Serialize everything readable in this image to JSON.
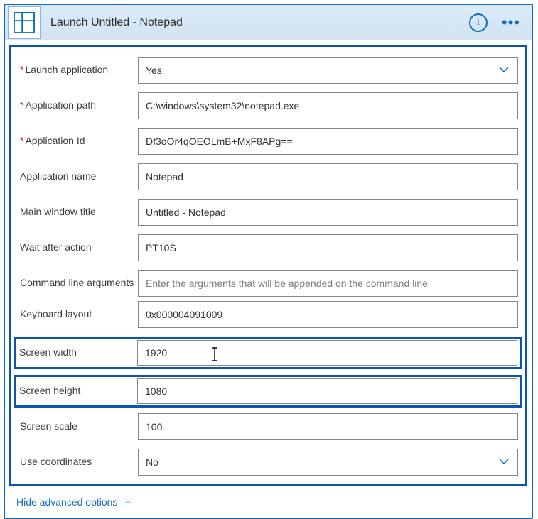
{
  "header": {
    "title": "Launch Untitled - Notepad"
  },
  "fields": {
    "launch_application": {
      "label": "Launch application",
      "value": "Yes"
    },
    "application_path": {
      "label": "Application path",
      "value": "C:\\windows\\system32\\notepad.exe"
    },
    "application_id": {
      "label": "Application Id",
      "value": "Df3oOr4qOEOLmB+MxF8APg=="
    },
    "application_name": {
      "label": "Application name",
      "value": "Notepad"
    },
    "main_window_title": {
      "label": "Main window title",
      "value": "Untitled - Notepad"
    },
    "wait_after_action": {
      "label": "Wait after action",
      "value": "PT10S"
    },
    "command_line_args": {
      "label": "Command line arguments",
      "placeholder": "Enter the arguments that will be appended on the command line"
    },
    "keyboard_layout": {
      "label": "Keyboard layout",
      "value": "0x000004091009"
    },
    "screen_width": {
      "label": "Screen width",
      "value": "1920"
    },
    "screen_height": {
      "label": "Screen height",
      "value": "1080"
    },
    "screen_scale": {
      "label": "Screen scale",
      "value": "100"
    },
    "use_coordinates": {
      "label": "Use coordinates",
      "value": "No"
    }
  },
  "footer": {
    "advanced_toggle": "Hide advanced options"
  }
}
